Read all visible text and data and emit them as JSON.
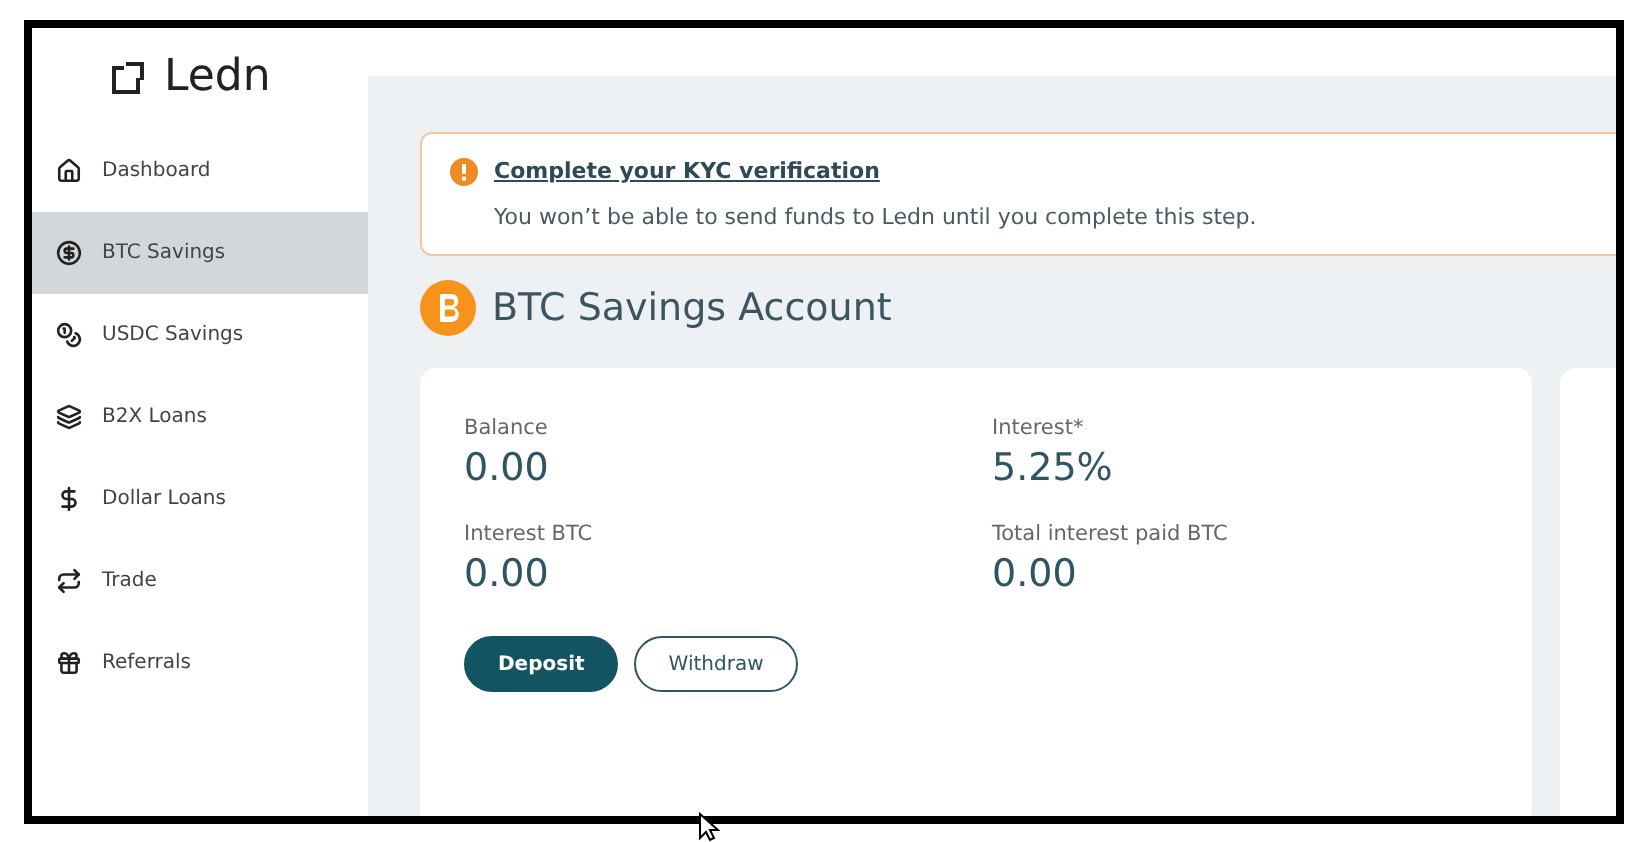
{
  "logo": {
    "text": "Ledn"
  },
  "sidebar": {
    "items": [
      {
        "label": "Dashboard",
        "selected": false
      },
      {
        "label": "BTC Savings",
        "selected": true
      },
      {
        "label": "USDC Savings",
        "selected": false
      },
      {
        "label": "B2X Loans",
        "selected": false
      },
      {
        "label": "Dollar Loans",
        "selected": false
      },
      {
        "label": "Trade",
        "selected": false
      },
      {
        "label": "Referrals",
        "selected": false
      }
    ]
  },
  "alert": {
    "title": "Complete your KYC verification",
    "message": "You won’t be able to send funds to Ledn until you complete this step."
  },
  "heading": "BTC Savings Account",
  "stats": [
    {
      "label": "Balance",
      "value": "0.00"
    },
    {
      "label": "Interest*",
      "value": "5.25%"
    },
    {
      "label": "Interest BTC",
      "value": "0.00"
    },
    {
      "label": "Total interest paid BTC",
      "value": "0.00"
    }
  ],
  "buttons": [
    {
      "label": "Deposit",
      "kind": "primary"
    },
    {
      "label": "Withdraw",
      "kind": "outline"
    }
  ]
}
